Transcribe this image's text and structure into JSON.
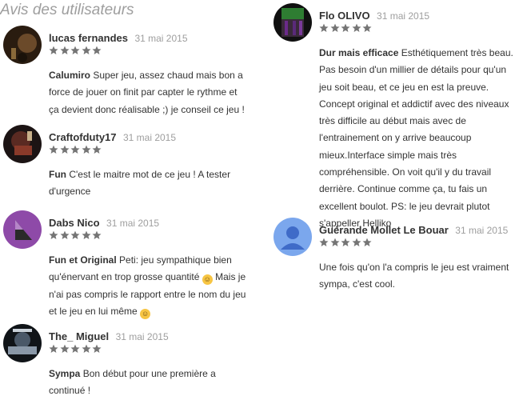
{
  "section_title": "Avis des utilisateurs",
  "colors": {
    "star": "#757575",
    "title": "#9e9e9e",
    "text": "#333333"
  },
  "reviews": [
    {
      "author": "lucas fernandes",
      "date": "31 mai 2015",
      "rating": 5,
      "title": "Calumiro",
      "text": "Super jeu, assez chaud mais bon a force de jouer on finit par capter le rythme et ça devient donc réalisable ;) je conseil ce jeu !"
    },
    {
      "author": "Craftofduty17",
      "date": "31 mai 2015",
      "rating": 5,
      "title": "Fun",
      "text": "C'est le maitre mot de ce jeu ! A tester d'urgence"
    },
    {
      "author": "Dabs Nico",
      "date": "31 mai 2015",
      "rating": 5,
      "title": "Fun et Original",
      "text": "Peti: jeu sympathique bien qu'énervant en trop grosse quantité",
      "text_cont": "Mais je n'ai pas compris le rapport entre le nom du jeu et le jeu en lui même"
    },
    {
      "author": "The_ Miguel",
      "date": "31 mai 2015",
      "rating": 5,
      "title": "Sympa",
      "text": "Bon début pour une première a continué !"
    },
    {
      "author": "Flo OLIVO",
      "date": "31 mai 2015",
      "rating": 5,
      "title": "Dur mais efficace",
      "text": "Esthétiquement très beau. Pas besoin d'un millier de détails pour qu'un jeu soit beau, et ce jeu en est la preuve. Concept original et addictif avec des niveaux très difficile au début mais avec de l'entrainement on y arrive beaucoup mieux.Interface simple mais très compréhensible. On voit qu'il y du travail derrière. Continue comme ça, tu fais un excellent boulot. PS: le jeu devrait plutot s'appeller Helliko"
    },
    {
      "author": "Guérande Mollet Le Bouar",
      "date": "31 mai 2015",
      "rating": 5,
      "title": "",
      "text": "Une fois qu'on l'a compris le jeu est vraiment sympa, c'est cool."
    }
  ]
}
